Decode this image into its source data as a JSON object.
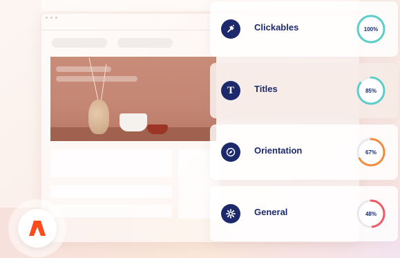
{
  "brand": {
    "logo_icon": "accessibility-logo-icon",
    "accent": "#ff4a1c"
  },
  "audit": {
    "items": [
      {
        "label": "Clickables",
        "value": "100%",
        "level": 1.0,
        "icon": "pointer-click-icon",
        "color": "#5ccdc8"
      },
      {
        "label": "Titles",
        "value": "85%",
        "level": 0.85,
        "icon": "title-t-icon",
        "color": "#5ccdc8"
      },
      {
        "label": "Orientation",
        "value": "67%",
        "level": 0.67,
        "icon": "compass-icon",
        "color": "#f58a3a"
      },
      {
        "label": "General",
        "value": "48%",
        "level": 0.48,
        "icon": "gear-icon",
        "color": "#f05a64"
      }
    ]
  },
  "colors": {
    "primary": "#1c2a6b",
    "track": "#ede7ea"
  }
}
